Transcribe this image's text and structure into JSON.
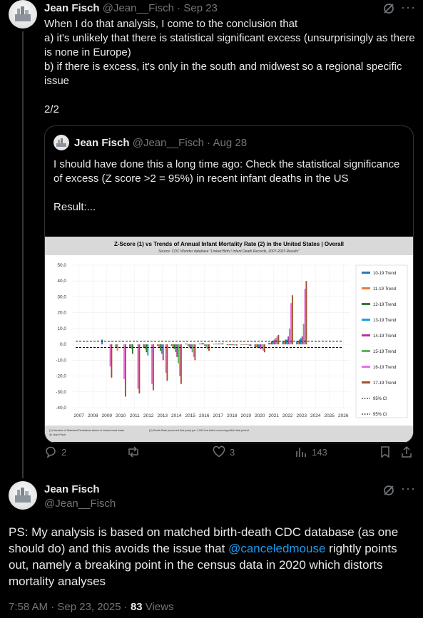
{
  "tweet1": {
    "author_name": "Jean Fisch",
    "handle": "@Jean__Fisch",
    "date": "Sep 23",
    "text": "When I do that analysis, I come to the conclusion that\na) it's unlikely that there is statistical significant excess (unsurprisingly as there is none in Europe)\nb) if there is excess, it's only in the south and midwest so a regional specific issue\n\n2/2",
    "quote": {
      "author_name": "Jean Fisch",
      "handle": "@Jean__Fisch",
      "date": "Aug 28",
      "text": "I should have done this a long time ago: Check the statistical significance of excess (Z score >2 = 95%) in recent infant deaths in the US\n\nResult:..."
    },
    "stats": {
      "replies": "2",
      "retweets": "",
      "likes": "3",
      "views": "143"
    }
  },
  "tweet2": {
    "author_name": "Jean Fisch",
    "handle": "@Jean__Fisch",
    "text_before": "PS: My analysis is based on matched birth-death CDC database (as one should do) and this avoids the issue that ",
    "mention": "@canceledmouse",
    "text_after": " rightly points out, namely a breaking point in the census data in 2020 which distorts mortality analyses",
    "time": "7:58 AM · Sep 23, 2025 · ",
    "views_count": "83",
    "views_label": " Views"
  },
  "icons": [
    "grok-icon",
    "more-icon",
    "reply-icon",
    "retweet-icon",
    "like-icon",
    "views-icon",
    "bookmark-icon",
    "share-icon"
  ],
  "chart_data": {
    "type": "bar",
    "title": "Z-Score (1) vs Trends of Annual Infant Mortality Rate (2) in the United States | Overall",
    "subtitle": "Source: CDC Wonder database \"Linked Birth / Infant Death Records, 2007-2023 Results\"",
    "categories": [
      "2007",
      "2008",
      "2009",
      "2010",
      "2011",
      "2012",
      "2013",
      "2014",
      "2015",
      "2016",
      "2017",
      "2018",
      "2019",
      "2020",
      "2021",
      "2022",
      "2023",
      "2024",
      "2025",
      "2026"
    ],
    "yticks": [
      "50,0",
      "40,0",
      "30,0",
      "20,0",
      "10,0",
      "0,0",
      "-10,0",
      "-20,0",
      "-30,0",
      "-40,0"
    ],
    "ylim": [
      -40,
      50
    ],
    "ci": 2,
    "series": [
      {
        "name": "10-19 Trend",
        "color": "#2e75b6",
        "values": [
          null,
          null,
          3,
          -2,
          -2,
          -2,
          -1,
          -1,
          0.5,
          0.5,
          0.3,
          -0.5,
          0,
          -2,
          1,
          2,
          2,
          null,
          null,
          null
        ]
      },
      {
        "name": "11-19 Trend",
        "color": "#ed7d31",
        "values": [
          null,
          null,
          null,
          -4,
          -3,
          -3,
          -2,
          -2,
          0.5,
          0.5,
          0.3,
          -0.5,
          0,
          -2,
          1,
          2,
          2,
          null,
          null,
          null
        ]
      },
      {
        "name": "12-19 Trend",
        "color": "#2e7d32",
        "values": [
          null,
          null,
          null,
          null,
          -6,
          -5,
          -4,
          -3,
          -1,
          0.8,
          0.4,
          -0.5,
          0,
          -2,
          2,
          3,
          3,
          null,
          null,
          null
        ]
      },
      {
        "name": "13-19 Trend",
        "color": "#17a2e0",
        "values": [
          null,
          null,
          null,
          null,
          null,
          -7,
          -6,
          -5,
          -2,
          0.8,
          0.4,
          -0.5,
          0,
          -2,
          2,
          3,
          4,
          null,
          null,
          null
        ]
      },
      {
        "name": "14-19 Trend",
        "color": "#b03a9a",
        "values": [
          null,
          null,
          null,
          null,
          null,
          null,
          -10,
          -8,
          -3,
          -1,
          0.5,
          -0.5,
          0,
          -3,
          3,
          5,
          5,
          null,
          null,
          null
        ]
      },
      {
        "name": "15-19 Trend",
        "color": "#5cb85c",
        "values": [
          null,
          null,
          null,
          null,
          null,
          null,
          null,
          -12,
          -5,
          -2,
          0.6,
          -0.6,
          0,
          -3,
          4,
          10,
          13,
          null,
          null,
          null
        ]
      },
      {
        "name": "16-19 Trend",
        "color": "#f06ee0",
        "values": [
          null,
          null,
          -14,
          -22,
          -28,
          -25,
          -18,
          -20,
          -8,
          -3,
          0.6,
          -0.6,
          -1,
          -4,
          5,
          26,
          35,
          null,
          null,
          null
        ]
      },
      {
        "name": "17-19 Trend",
        "color": "#a0522d",
        "values": [
          null,
          null,
          -21,
          -33,
          -31,
          -29,
          -23,
          -25,
          -10,
          -4,
          0.7,
          -0.7,
          -1,
          -5,
          6,
          31,
          40,
          null,
          null,
          null
        ]
      }
    ],
    "ci_series": [
      "95% CI",
      "95% CI"
    ],
    "footnote1": "(1) Number of Standard Deviations above or below trend basis",
    "footnote2": "(2) Death Rate (occurred that year) per 1,000 live births occurring within that period",
    "credit": "@ Jean Fisch"
  }
}
